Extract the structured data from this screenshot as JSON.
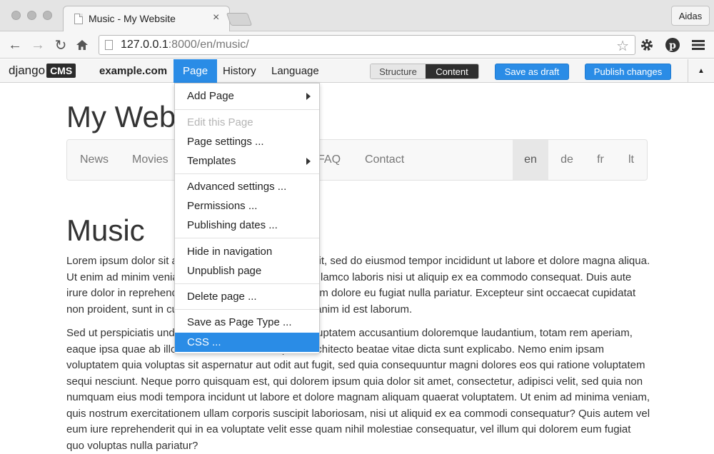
{
  "browser": {
    "tab_title": "Music - My Website",
    "tab_close": "×",
    "user_label": "Aidas",
    "url_host": "127.0.0.1",
    "url_path": ":8000/en/music/"
  },
  "cms_toolbar": {
    "logo_text": "django",
    "logo_badge": "CMS",
    "site": "example.com",
    "menus": [
      "Page",
      "History",
      "Language"
    ],
    "structure_label": "Structure",
    "content_label": "Content",
    "save_draft_label": "Save as draft",
    "publish_label": "Publish changes"
  },
  "page": {
    "site_title": "My Website",
    "nav": [
      "News",
      "Movies",
      "FAQ",
      "Contact"
    ],
    "languages": [
      "en",
      "de",
      "fr",
      "lt"
    ],
    "heading": "Music",
    "paragraph1": "Lorem ipsum dolor sit amet, consectetur adipiscing elit, sed do eiusmod tempor incididunt ut labore et dolore magna aliqua. Ut enim ad minim veniam, quis nostrud exercitation ullamco laboris nisi ut aliquip ex ea commodo consequat. Duis aute irure dolor in reprehenderit in voluptate velit esse cillum dolore eu fugiat nulla pariatur. Excepteur sint occaecat cupidatat non proident, sunt in culpa qui officia deserunt mollit anim id est laborum.",
    "paragraph2": "Sed ut perspiciatis unde omnis iste natus error sit voluptatem accusantium doloremque laudantium, totam rem aperiam, eaque ipsa quae ab illo inventore veritatis et quasi architecto beatae vitae dicta sunt explicabo. Nemo enim ipsam voluptatem quia voluptas sit aspernatur aut odit aut fugit, sed quia consequuntur magni dolores eos qui ratione voluptatem sequi nesciunt. Neque porro quisquam est, qui dolorem ipsum quia dolor sit amet, consectetur, adipisci velit, sed quia non numquam eius modi tempora incidunt ut labore et dolore magnam aliquam quaerat voluptatem. Ut enim ad minima veniam, quis nostrum exercitationem ullam corporis suscipit laboriosam, nisi ut aliquid ex ea commodi consequatur? Quis autem vel eum iure reprehenderit qui in ea voluptate velit esse quam nihil molestiae consequatur, vel illum qui dolorem eum fugiat quo voluptas nulla pariatur?"
  },
  "dropdown": {
    "add_page": "Add Page",
    "edit_page": "Edit this Page",
    "page_settings": "Page settings ...",
    "templates": "Templates",
    "advanced_settings": "Advanced settings ...",
    "permissions": "Permissions ...",
    "publishing_dates": "Publishing dates ...",
    "hide_in_navigation": "Hide in navigation",
    "unpublish_page": "Unpublish page",
    "delete_page": "Delete page ...",
    "save_as_page_type": "Save as Page Type ...",
    "css": "CSS ..."
  },
  "colors": {
    "accent": "#2a8ce6",
    "content_toggle": "#2e2e2e"
  }
}
